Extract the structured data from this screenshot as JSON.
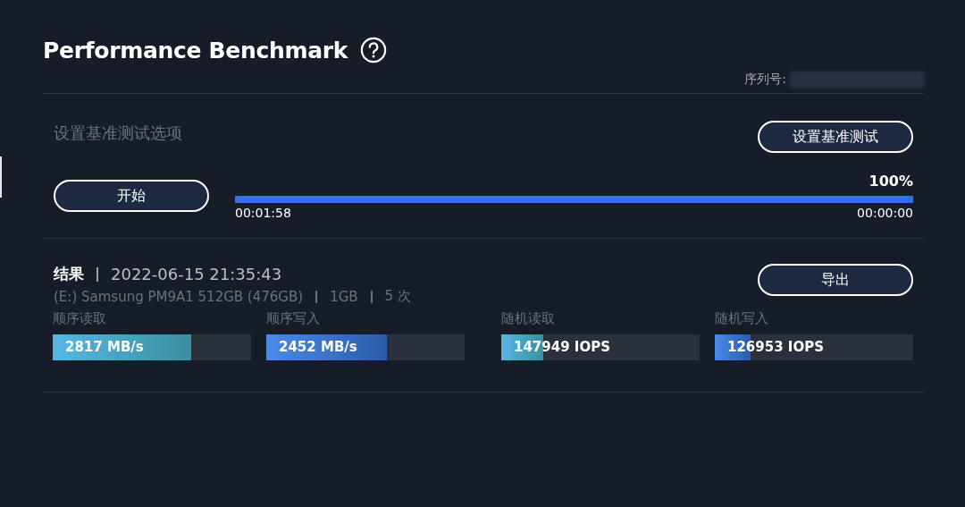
{
  "title": "Performance Benchmark",
  "serial": {
    "label": "序列号:"
  },
  "setup": {
    "heading": "设置基准测试选项",
    "button": "设置基准测试"
  },
  "run": {
    "button": "开始",
    "progress": {
      "level": 1,
      "percent": "100%",
      "elapsed": "00:01:58",
      "remaining": "00:00:00"
    }
  },
  "results": {
    "heading": "结果",
    "timestamp": "2022-06-15 21:35:43",
    "drive": "(E:) Samsung PM9A1 512GB (476GB)",
    "size": "1GB",
    "runs": "5 次",
    "export_button": "导出",
    "metrics": [
      {
        "label": "顺序读取",
        "value": "2817 MB/s",
        "level": 0.7,
        "kind": "read"
      },
      {
        "label": "顺序写入",
        "value": "2452 MB/s",
        "level": 0.61,
        "kind": "write"
      },
      {
        "label": "随机读取",
        "value": "147949 IOPS",
        "level": 0.21,
        "kind": "read"
      },
      {
        "label": "随机写入",
        "value": "126953 IOPS",
        "level": 0.18,
        "kind": "write"
      }
    ]
  }
}
